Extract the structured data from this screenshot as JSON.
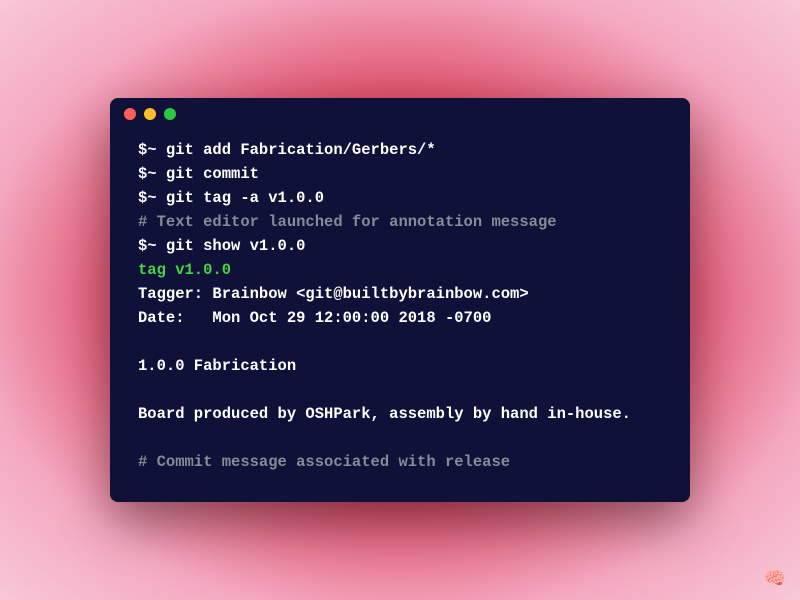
{
  "window": {
    "controls": {
      "close_color": "#ff5f56",
      "minimize_color": "#ffbd2e",
      "maximize_color": "#27c93f"
    }
  },
  "terminal": {
    "lines": {
      "l0": "$~ git add Fabrication/Gerbers/*",
      "l1": "$~ git commit",
      "l2": "$~ git tag -a v1.0.0",
      "l3": "# Text editor launched for annotation message",
      "l4": "$~ git show v1.0.0",
      "l5": "tag v1.0.0",
      "l6": "Tagger: Brainbow <git@builtbybrainbow.com>",
      "l7": "Date:   Mon Oct 29 12:00:00 2018 -0700",
      "l8": "1.0.0 Fabrication",
      "l9": "Board produced by OSHPark, assembly by hand in-house.",
      "l10": "# Commit message associated with release"
    }
  },
  "watermark": "🧠"
}
